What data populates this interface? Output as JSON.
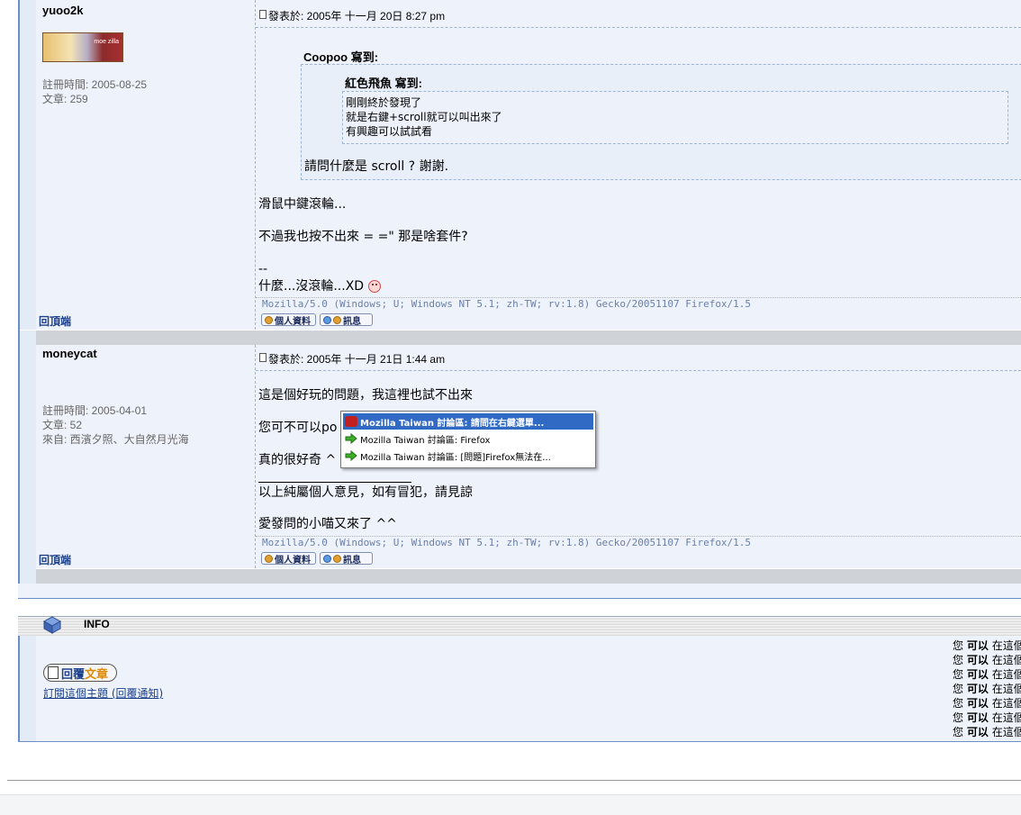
{
  "post1": {
    "username": "yuoo2k",
    "avatar_text": "moe zilla",
    "register": "註冊時間: 2005-08-25",
    "articles": "文章: 259",
    "posted": "發表於: 2005年 十一月 20日 8:27 pm",
    "quote_outer_author": "Coopoo 寫到:",
    "quote_inner_author": "紅色飛魚 寫到:",
    "quote_inner_lines": [
      "剛剛終於發現了",
      "就是右鍵+scroll就可以叫出來了",
      "有興趣可以試試看"
    ],
    "quote_outer_text": "請問什麼是 scroll ? 謝謝.",
    "body_lines": [
      "滑鼠中鍵滾輪...",
      "不過我也按不出來 = =\" 那是啥套件?"
    ],
    "sig_dash": "--",
    "sig_line": "什麼...沒滾輪...XD",
    "useragent": "Mozilla/5.0 (Windows; U; Windows NT 5.1; zh-TW; rv:1.8) Gecko/20051107 Firefox/1.5",
    "back_to_top": "回頂端",
    "profile_btn": "個人資料",
    "pm_btn": "訊息"
  },
  "post2": {
    "username": "moneycat",
    "register": "註冊時間: 2005-04-01",
    "articles": "文章: 52",
    "from": "來自: 西濱夕照、大自然月光海",
    "posted": "發表於: 2005年 十一月 21日 1:44 am",
    "line1": "這是個好玩的問題，我這裡也試不出來",
    "line2": "您可不可以po",
    "line3": "真的很好奇 ^",
    "sig_line1": "以上純屬個人意見，如有冒犯，請見諒",
    "sig_line2": "愛發問的小喵又來了 ^^",
    "useragent": "Mozilla/5.0 (Windows; U; Windows NT 5.1; zh-TW; rv:1.8) Gecko/20051107 Firefox/1.5",
    "back_to_top": "回頂端",
    "profile_btn": "個人資料",
    "pm_btn": "訊息"
  },
  "popup": {
    "items": [
      "Mozilla Taiwan 討論區: 請問在右鍵選單...",
      "Mozilla Taiwan 討論區: Firefox",
      "Mozilla Taiwan 討論區: [問題]Firefox無法在..."
    ]
  },
  "info": {
    "title": "INFO",
    "reply_btn_a": "回覆",
    "reply_btn_b": "文章",
    "subscribe": "訂閱這個主題 (回覆通知)",
    "perm_prefix": "您",
    "perm_strong": "可以",
    "perm_suffix": "在這個"
  },
  "colors": {
    "accent": "#316ac5",
    "post_bg": "#eef3fb",
    "link": "#1b3f8b"
  }
}
